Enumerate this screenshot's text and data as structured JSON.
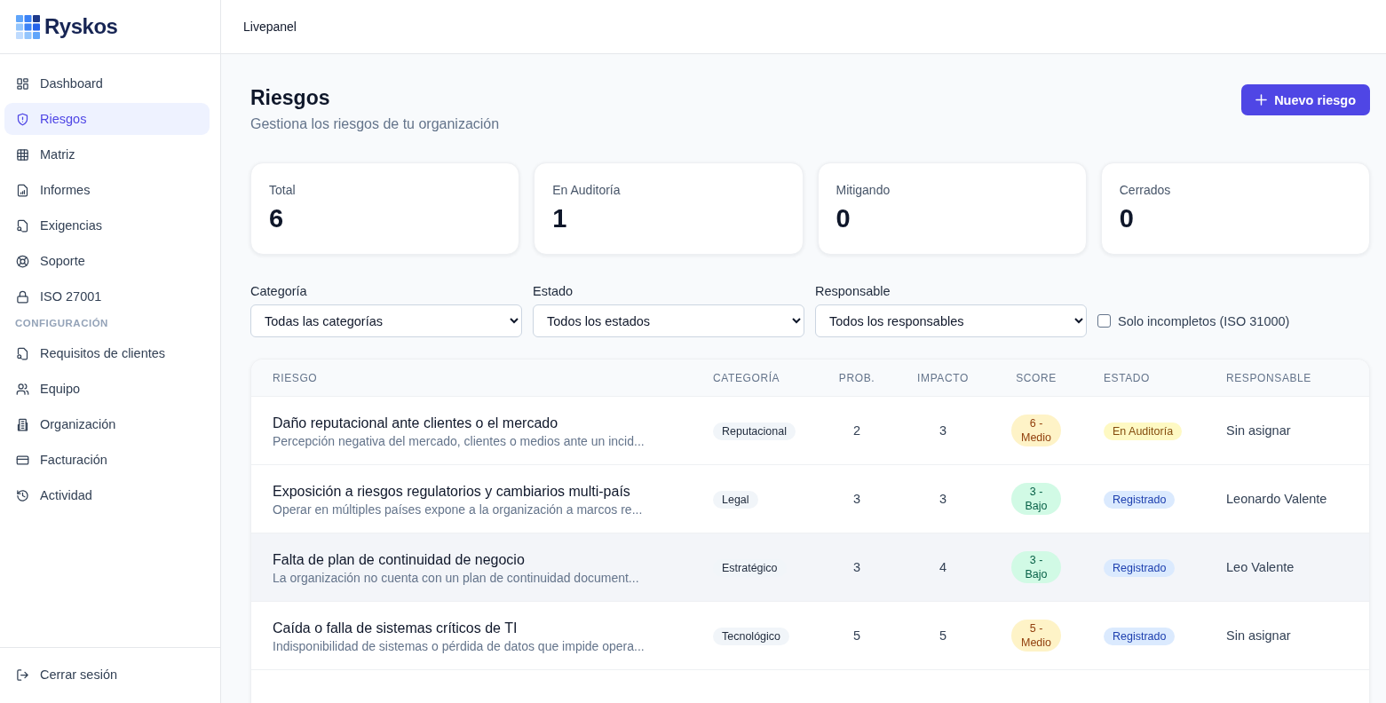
{
  "brand": {
    "name": "Ryskos"
  },
  "topbar": {
    "title": "Livepanel"
  },
  "sidebar": {
    "items": [
      {
        "label": "Dashboard",
        "selected": false
      },
      {
        "label": "Riesgos",
        "selected": true
      },
      {
        "label": "Matriz",
        "selected": false
      },
      {
        "label": "Informes",
        "selected": false
      },
      {
        "label": "Exigencias",
        "selected": false
      },
      {
        "label": "Soporte",
        "selected": false
      },
      {
        "label": "ISO 27001",
        "selected": false
      }
    ],
    "section": "CONFIGURACIÓN",
    "config_items": [
      {
        "label": "Requisitos de clientes",
        "selected": false
      },
      {
        "label": "Equipo",
        "selected": false
      },
      {
        "label": "Organización",
        "selected": false
      },
      {
        "label": "Facturación",
        "selected": false
      },
      {
        "label": "Actividad",
        "selected": false
      }
    ],
    "logout": "Cerrar sesión"
  },
  "page": {
    "title": "Riesgos",
    "subtitle": "Gestiona los riesgos de tu organización",
    "new_button": "Nuevo riesgo"
  },
  "stats": [
    {
      "label": "Total",
      "value": "6"
    },
    {
      "label": "En Auditoría",
      "value": "1"
    },
    {
      "label": "Mitigando",
      "value": "0"
    },
    {
      "label": "Cerrados",
      "value": "0"
    }
  ],
  "filters": [
    {
      "label": "Categoría",
      "value": "Todas las categorías"
    },
    {
      "label": "Estado",
      "value": "Todos los estados"
    },
    {
      "label": "Responsable",
      "value": "Todos los responsables"
    }
  ],
  "incomplete_filter": {
    "label": "Solo incompletos (ISO 31000)",
    "checked": false
  },
  "table": {
    "columns": [
      "RIESGO",
      "CATEGORÍA",
      "PROB.",
      "IMPACTO",
      "SCORE",
      "ESTADO",
      "RESPONSABLE"
    ],
    "rows": [
      {
        "title": "Daño reputacional ante clientes o el mercado",
        "description": "Percepción negativa del mercado, clientes o medios ante un incid...",
        "category": "Reputacional",
        "prob": "2",
        "impact": "3",
        "score": {
          "label": "6 - Medio",
          "color": "#fef3c7"
        },
        "status": {
          "label": "En Auditoría",
          "color": "#fef9c3"
        },
        "owner": "Sin asignar",
        "selected": false
      },
      {
        "title": "Exposición a riesgos regulatorios y cambiarios multi-país",
        "description": "Operar en múltiples países expone a la organización a marcos re...",
        "category": "Legal",
        "prob": "3",
        "impact": "3",
        "score": {
          "label": "3 - Bajo",
          "color": "#d1fae5"
        },
        "status": {
          "label": "Registrado",
          "color": "#dbeafe"
        },
        "owner": "Leonardo Valente",
        "selected": false
      },
      {
        "title": "Falta de plan de continuidad de negocio",
        "description": "La organización no cuenta con un plan de continuidad document...",
        "category": "Estratégico",
        "prob": "3",
        "impact": "4",
        "score": {
          "label": "3 - Bajo",
          "color": "#d1fae5"
        },
        "status": {
          "label": "Registrado",
          "color": "#dbeafe"
        },
        "owner": "Leo Valente",
        "selected": true
      },
      {
        "title": "Caída o falla de sistemas críticos de TI",
        "description": "Indisponibilidad de sistemas o pérdida de datos que impide opera...",
        "category": "Tecnológico",
        "prob": "5",
        "impact": "5",
        "score": {
          "label": "5 - Medio",
          "color": "#fef3c7"
        },
        "status": {
          "label": "Registrado",
          "color": "#dbeafe"
        },
        "owner": "Sin asignar",
        "selected": false
      }
    ]
  }
}
